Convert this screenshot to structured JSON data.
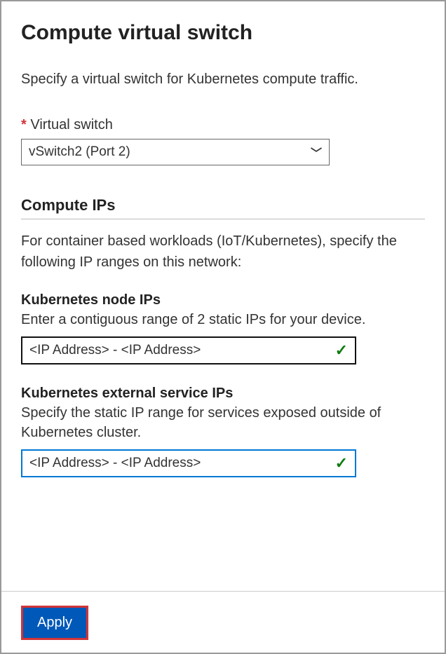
{
  "page": {
    "title": "Compute virtual switch",
    "description": "Specify a virtual switch for Kubernetes compute traffic."
  },
  "virtual_switch": {
    "required_mark": "*",
    "label": "Virtual switch",
    "selected": "vSwitch2 (Port 2)"
  },
  "compute_ips": {
    "heading": "Compute IPs",
    "description": "For container based workloads (IoT/Kubernetes), specify the following IP ranges on this network:"
  },
  "node_ips": {
    "heading": "Kubernetes node IPs",
    "description": "Enter a contiguous range of 2 static IPs for your device.",
    "placeholder": "<IP Address> - <IP Address>"
  },
  "service_ips": {
    "heading": "Kubernetes external service IPs",
    "description": "Specify the static IP range for services exposed outside of Kubernetes cluster.",
    "placeholder": "<IP Address> - <IP Address>"
  },
  "actions": {
    "apply": "Apply"
  }
}
